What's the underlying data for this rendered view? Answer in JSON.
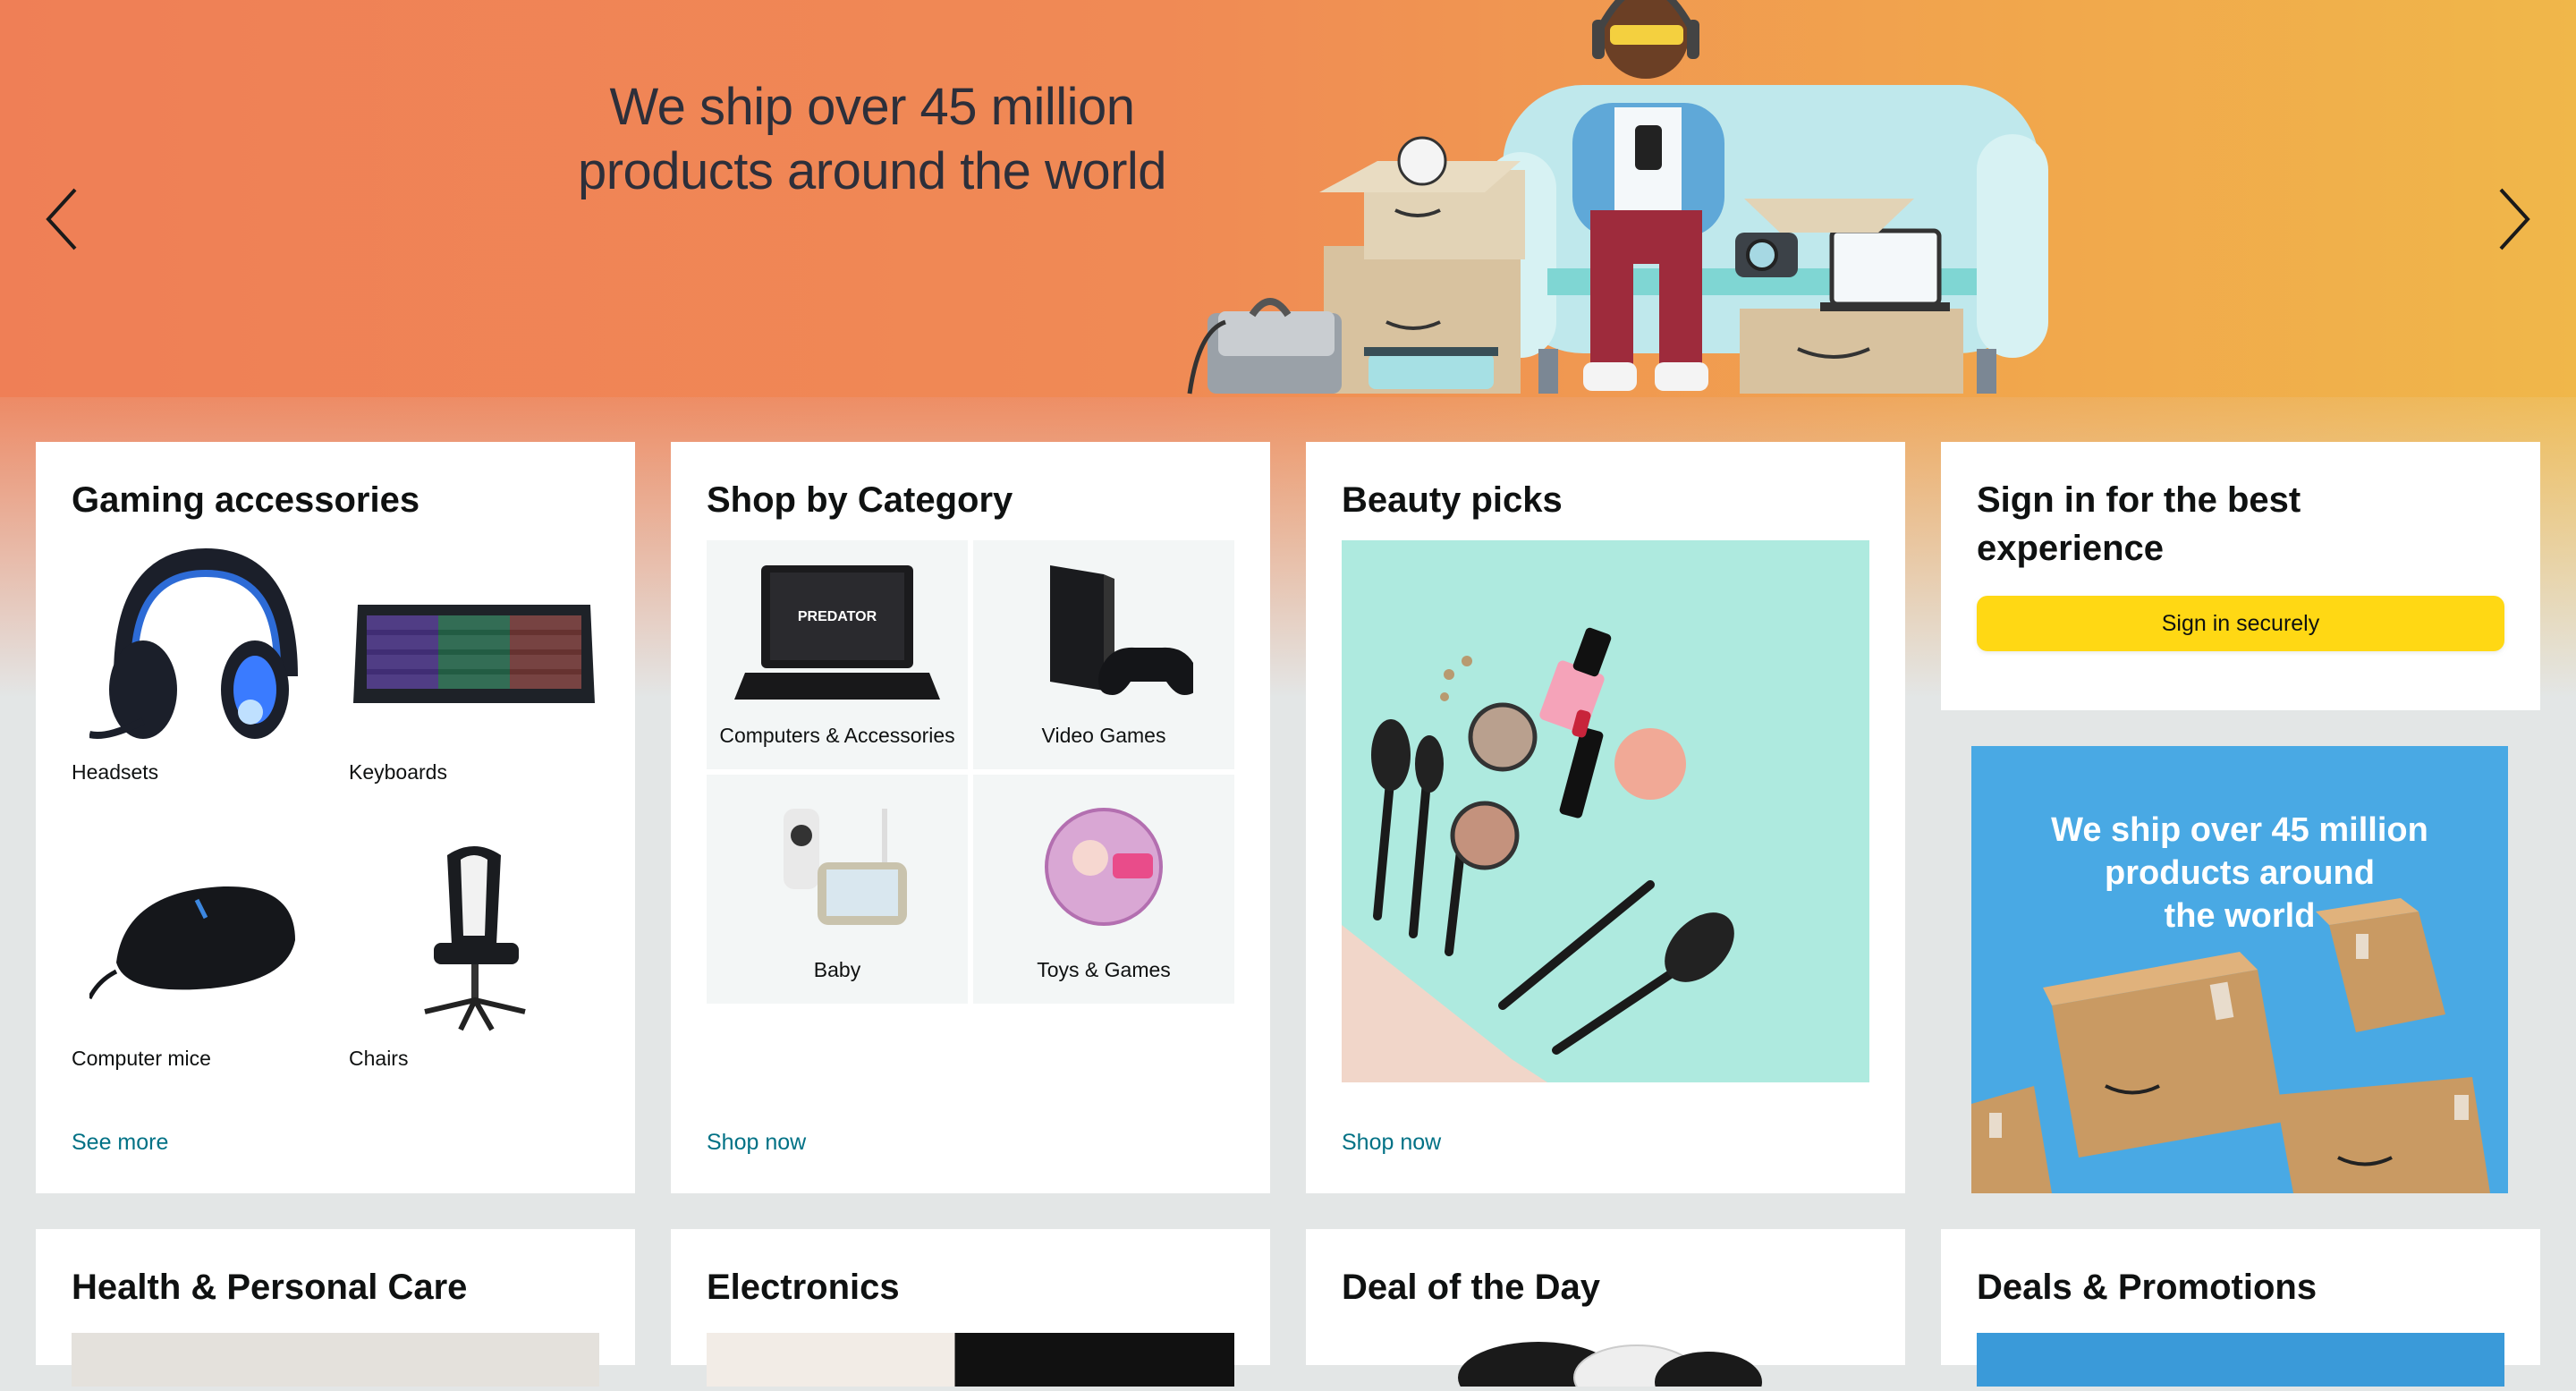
{
  "hero": {
    "title_line1": "We ship over 45 million",
    "title_line2": "products around the world",
    "prev_icon": "chevron-left-icon",
    "next_icon": "chevron-right-icon",
    "colors": {
      "left": "#ef7f56",
      "right": "#f0b74a",
      "title": "#2d2f3a"
    }
  },
  "cards": {
    "gaming": {
      "title": "Gaming accessories",
      "items": [
        {
          "label": "Headsets"
        },
        {
          "label": "Keyboards"
        },
        {
          "label": "Computer mice"
        },
        {
          "label": "Chairs"
        }
      ],
      "link": "See more"
    },
    "category": {
      "title": "Shop by Category",
      "items": [
        {
          "label": "Computers & Accessories"
        },
        {
          "label": "Video Games"
        },
        {
          "label": "Baby"
        },
        {
          "label": "Toys & Games"
        }
      ],
      "link": "Shop now"
    },
    "beauty": {
      "title": "Beauty picks",
      "link": "Shop now"
    },
    "signin": {
      "title_line1": "Sign in for the best",
      "title_line2": "experience",
      "button": "Sign in securely"
    },
    "promo": {
      "line1": "We ship over 45 million",
      "line2": "products around",
      "line3": "the world"
    },
    "health": {
      "title": "Health & Personal Care"
    },
    "electronics": {
      "title": "Electronics"
    },
    "deal": {
      "title": "Deal of the Day"
    },
    "deals_promos": {
      "title": "Deals & Promotions"
    }
  },
  "colors": {
    "page_bg": "#e3e6e6",
    "link": "#007185",
    "button": "#ffd814",
    "promo_bg": "#49a9e4"
  }
}
